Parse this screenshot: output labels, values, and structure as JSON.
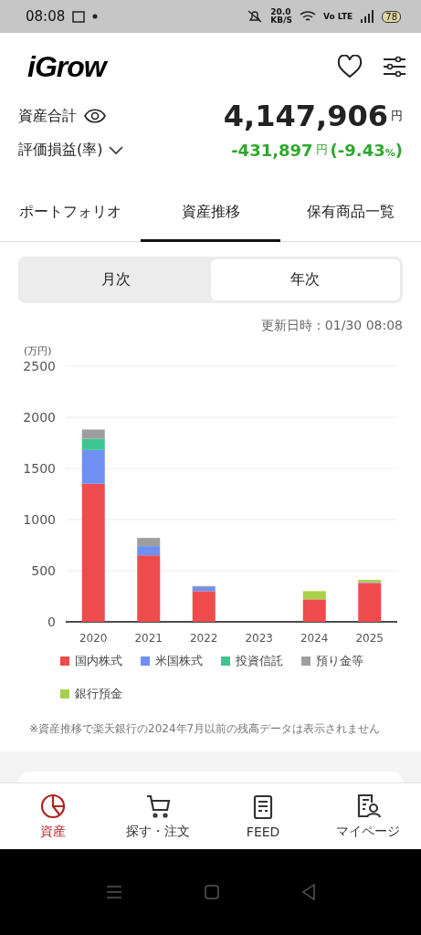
{
  "status_bar": {
    "time": "08:08",
    "speed": "20.0",
    "speed_unit": "KB/S",
    "network": "Vo LTE",
    "battery": "78"
  },
  "header": {
    "logo": "iGrow"
  },
  "summary": {
    "total_label": "資産合計",
    "total_value": "4,147,906",
    "total_unit": "円",
    "pl_label": "評価損益(率)",
    "pl_value": "-431,897",
    "pl_unit": "円",
    "pl_open": "(",
    "pl_rate": "-9.43",
    "pl_rate_unit": "%",
    "pl_close": ")"
  },
  "tabs": [
    {
      "label": "ポートフォリオ",
      "selected": false
    },
    {
      "label": "資産推移",
      "selected": true
    },
    {
      "label": "保有商品一覧",
      "selected": false
    }
  ],
  "period": [
    {
      "label": "月次",
      "selected": false
    },
    {
      "label": "年次",
      "selected": true
    }
  ],
  "updated": "更新日時：01/30 08:08",
  "chart": {
    "unit": "(万円)",
    "chart_data": {
      "type": "bar",
      "stacked": true,
      "grid": true,
      "categories": [
        "2020",
        "2021",
        "2022",
        "2023",
        "2024",
        "2025"
      ],
      "ylim": [
        0,
        2500
      ],
      "yticks": [
        0,
        500,
        1000,
        1500,
        2000,
        2500
      ],
      "series": [
        {
          "name": "国内株式",
          "color": "#ee4c4c",
          "values": [
            1350,
            650,
            300,
            0,
            220,
            380
          ]
        },
        {
          "name": "米国株式",
          "color": "#6f8ff5",
          "values": [
            330,
            90,
            40,
            0,
            0,
            0
          ]
        },
        {
          "name": "投資信託",
          "color": "#3cc68f",
          "values": [
            110,
            0,
            0,
            0,
            0,
            0
          ]
        },
        {
          "name": "預り金等",
          "color": "#9e9e9e",
          "values": [
            90,
            80,
            10,
            0,
            0,
            10
          ]
        },
        {
          "name": "銀行預金",
          "color": "#a8d24a",
          "values": [
            0,
            0,
            0,
            0,
            80,
            20
          ]
        }
      ]
    }
  },
  "note": "※資産推移で楽天銀行の2024年7月以前の残高データは表示されません",
  "bottom_nav": [
    {
      "label": "資産",
      "selected": true
    },
    {
      "label": "探す・注文",
      "selected": false
    },
    {
      "label": "FEED",
      "selected": false
    },
    {
      "label": "マイページ",
      "selected": false
    }
  ]
}
